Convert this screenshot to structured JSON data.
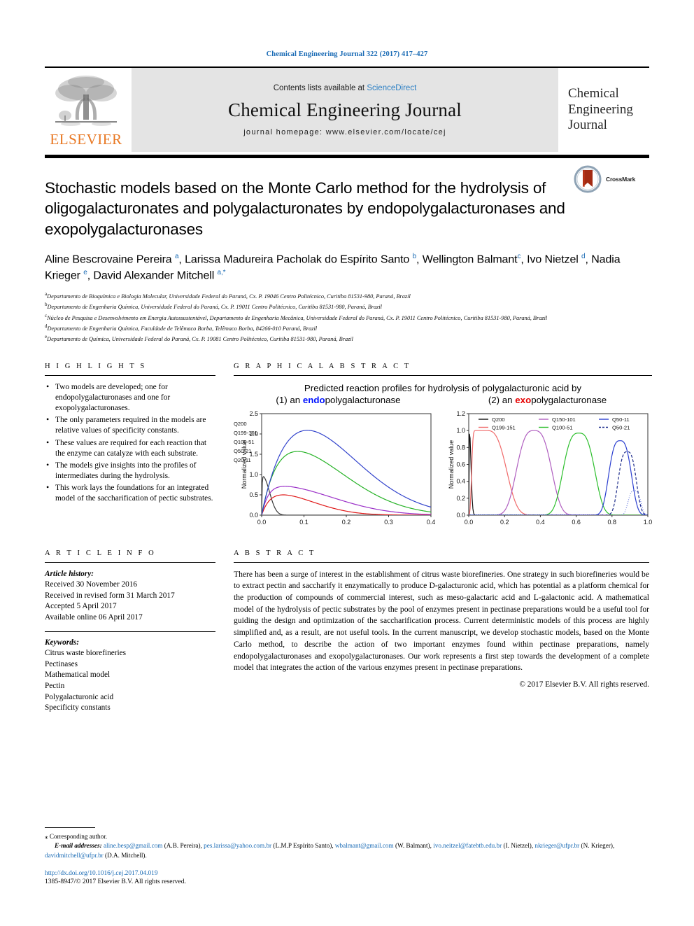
{
  "running_head": "Chemical Engineering Journal 322 (2017) 417–427",
  "masthead": {
    "publisher_logo_text": "ELSEVIER",
    "contents_prefix": "Contents lists available at",
    "contents_link": "ScienceDirect",
    "journal_name": "Chemical Engineering Journal",
    "homepage": "journal homepage: www.elsevier.com/locate/cej",
    "cover_title_lines": [
      "Chemical",
      "Engineering",
      "Journal"
    ]
  },
  "article": {
    "title": "Stochastic models based on the Monte Carlo method for the hydrolysis of oligogalacturonates and polygalacturonates by endopolygalacturonases and exopolygalacturonases",
    "crossmark_label": "CrossMark",
    "authors_html": "Aline Bescrovaine Pereira <sup>a</sup>, Larissa Madureira Pacholak do Espírito Santo <sup>b</sup>, Wellington Balmant<sup>c</sup>, Ivo Nietzel <sup>d</sup>, Nadia Krieger <sup>e</sup>, David Alexander Mitchell <sup>a,*</sup>",
    "affiliations": [
      {
        "marker": "a",
        "text": "Departamento de Bioquímica e Biologia Molecular, Universidade Federal do Paraná, Cx. P. 19046 Centro Politécnico, Curitiba 81531-980, Paraná, Brazil"
      },
      {
        "marker": "b",
        "text": "Departamento de Engenharia Química, Universidade Federal do Paraná, Cx. P. 19011 Centro Politécnico, Curitiba 81531-980, Paraná, Brazil"
      },
      {
        "marker": "c",
        "text": "Núcleo de Pesquisa e Desenvolvimento em Energia Autossustentável, Departamento de Engenharia Mecânica, Universidade Federal do Paraná, Cx. P. 19011 Centro Politécnico, Curitiba 81531-980, Paraná, Brazil"
      },
      {
        "marker": "d",
        "text": "Departamento de Engenharia Química, Faculdade de Telêmaco Borba, Telêmaco Borba, 84266-010 Paraná, Brazil"
      },
      {
        "marker": "e",
        "text": "Departamento de Química, Universidade Federal do Paraná, Cx. P. 19081 Centro Politécnico, Curitiba 81531-980, Paraná, Brazil"
      }
    ]
  },
  "highlights": {
    "heading": "H I G H L I G H T S",
    "items": [
      "Two models are developed; one for endopolygalacturonases and one for exopolygalacturonases.",
      "The only parameters required in the models are relative values of specificity constants.",
      "These values are required for each reaction that the enzyme can catalyze with each substrate.",
      "The models give insights into the profiles of intermediates during the hydrolysis.",
      "This work lays the foundations for an integrated model of the saccharification of pectic substrates."
    ]
  },
  "article_info": {
    "heading": "A R T I C L E   I N F O",
    "history_label": "Article history:",
    "history": [
      "Received 30 November 2016",
      "Received in revised form 31 March 2017",
      "Accepted 5 April 2017",
      "Available online 06 April 2017"
    ],
    "keywords_label": "Keywords:",
    "keywords": [
      "Citrus waste biorefineries",
      "Pectinases",
      "Mathematical model",
      "Pectin",
      "Polygalacturonic acid",
      "Specificity constants"
    ]
  },
  "graphical_abstract": {
    "heading": "G R A P H I C A L   A B S T R A C T"
  },
  "abstract": {
    "heading": "A B S T R A C T",
    "text": "There has been a surge of interest in the establishment of citrus waste biorefineries. One strategy in such biorefineries would be to extract pectin and saccharify it enzymatically to produce D-galacturonic acid, which has potential as a platform chemical for the production of compounds of commercial interest, such as meso-galactaric acid and L-galactonic acid. A mathematical model of the hydrolysis of pectic substrates by the pool of enzymes present in pectinase preparations would be a useful tool for guiding the design and optimization of the saccharification process. Current deterministic models of this process are highly simplified and, as a result, are not useful tools. In the current manuscript, we develop stochastic models, based on the Monte Carlo method, to describe the action of two important enzymes found within pectinase preparations, namely endopolygalacturonases and exopolygalacturonases. Our work represents a first step towards the development of a complete model that integrates the action of the various enzymes present in pectinase preparations.",
    "copyright": "© 2017 Elsevier B.V. All rights reserved."
  },
  "footnotes": {
    "corresponding": "Corresponding author.",
    "email_label": "E-mail addresses:",
    "emails": [
      {
        "address": "aline.besp@gmail.com",
        "owner": "(A.B. Pereira)"
      },
      {
        "address": "pes.larissa@yahoo.com.br",
        "owner": "(L.M.P Espírito Santo)"
      },
      {
        "address": "wbalmant@gmail.com",
        "owner": "(W. Balmant)"
      },
      {
        "address": "ivo.neitzel@fatebtb.edu.br",
        "owner": "(I. Nietzel)"
      },
      {
        "address": "nkrieger@ufpr.br",
        "owner": "(N. Krieger)"
      },
      {
        "address": "davidmitchell@ufpr.br",
        "owner": "(D.A. Mitchell)"
      }
    ],
    "doi": "http://dx.doi.org/10.1016/j.cej.2017.04.019",
    "issn_line": "1385-8947/© 2017 Elsevier B.V. All rights reserved."
  },
  "chart_data": [
    {
      "type": "line",
      "panel": "(1) an endopolygalacturonase",
      "title": "Predicted reaction profiles for hydrolysis of polygalacturonic acid by",
      "xlabel": "",
      "ylabel": "Normalized value",
      "xlim": [
        0.0,
        0.4
      ],
      "ylim": [
        0.0,
        2.5
      ],
      "xticks": [
        "0.0",
        "0.1",
        "0.2",
        "0.3",
        "0.4"
      ],
      "yticks": [
        "0.0",
        "0.5",
        "1.0",
        "1.5",
        "2.0",
        "2.5"
      ],
      "grid": false,
      "legend_position": "top-right",
      "series": [
        {
          "name": "Q200",
          "color": "#3a3a3a",
          "peak_x": 0.002,
          "peak_y": 0.95,
          "decay": 0.012
        },
        {
          "name": "Q199-101",
          "color": "#e01b1b",
          "peak_x": 0.042,
          "peak_y": 0.5,
          "decay": 0.075
        },
        {
          "name": "Q100-51",
          "color": "#9b30c8",
          "peak_x": 0.035,
          "peak_y": 0.71,
          "decay": 0.105
        },
        {
          "name": "Q50-21",
          "color": "#27b327",
          "peak_x": 0.078,
          "peak_y": 1.57,
          "decay": 0.115
        },
        {
          "name": "Q20-11",
          "color": "#3344cc",
          "peak_x": 0.125,
          "peak_y": 2.09,
          "decay": 0.125
        }
      ]
    },
    {
      "type": "line",
      "panel": "(2) an exopolygalacturonase",
      "title": "Predicted reaction profiles for hydrolysis of polygalacturonic acid by",
      "xlabel": "",
      "ylabel": "Normalized value",
      "xlim": [
        0.0,
        1.0
      ],
      "ylim": [
        0.0,
        1.2
      ],
      "xticks": [
        "0.0",
        "0.2",
        "0.4",
        "0.6",
        "0.8",
        "1.0"
      ],
      "yticks": [
        "0.0",
        "0.2",
        "0.4",
        "0.6",
        "0.8",
        "1.0",
        "1.2"
      ],
      "grid": false,
      "legend_position": "top",
      "series": [
        {
          "name": "Q200",
          "color": "#111111",
          "peak_x": 0.005,
          "peak_y": 1.0,
          "width": 0.02,
          "dash": "solid"
        },
        {
          "name": "Q199-151",
          "color": "#f06a6a",
          "peak_x": 0.1,
          "peak_y": 1.0,
          "width": 0.13,
          "dash": "solid"
        },
        {
          "name": "Q150-101",
          "color": "#b05fc0",
          "peak_x": 0.365,
          "peak_y": 1.0,
          "width": 0.115,
          "dash": "solid"
        },
        {
          "name": "Q100-51",
          "color": "#2dbf2d",
          "peak_x": 0.615,
          "peak_y": 0.97,
          "width": 0.105,
          "dash": "solid"
        },
        {
          "name": "Q50-11",
          "color": "#2b3fd0",
          "peak_x": 0.845,
          "peak_y": 0.88,
          "width": 0.075,
          "dash": "solid"
        },
        {
          "name": "Q50-21",
          "color": "#1b2a8a",
          "peak_x": 0.885,
          "peak_y": 0.75,
          "width": 0.06,
          "dash": "dashed"
        },
        {
          "name": "Q20-11",
          "color": "#6f7fe0",
          "peak_x": 0.925,
          "peak_y": 0.29,
          "width": 0.042,
          "dash": "dotted"
        }
      ]
    }
  ]
}
